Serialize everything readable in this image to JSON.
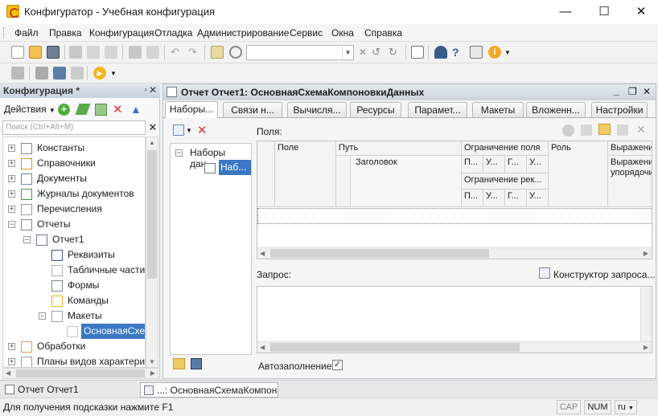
{
  "window": {
    "title": "Конфигуратор - Учебная конфигурация",
    "controls": [
      "—",
      "☐",
      "✕"
    ]
  },
  "menu": [
    "Файл",
    "Правка",
    "Конфигурация",
    "Отладка",
    "Администрирование",
    "Сервис",
    "Окна",
    "Справка"
  ],
  "left_panel": {
    "title": "Конфигурация *",
    "actions_label": "Действия",
    "search_placeholder": "Поиск (Ctrl+Alt+M)",
    "tree": [
      {
        "label": "Константы",
        "level": 0,
        "toggle": "+"
      },
      {
        "label": "Справочники",
        "level": 0,
        "toggle": "+"
      },
      {
        "label": "Документы",
        "level": 0,
        "toggle": "+"
      },
      {
        "label": "Журналы документов",
        "level": 0,
        "toggle": "+"
      },
      {
        "label": "Перечисления",
        "level": 0,
        "toggle": "+"
      },
      {
        "label": "Отчеты",
        "level": 0,
        "toggle": "−"
      },
      {
        "label": "Отчет1",
        "level": 1,
        "toggle": "−"
      },
      {
        "label": "Реквизиты",
        "level": 2,
        "toggle": ""
      },
      {
        "label": "Табличные части",
        "level": 2,
        "toggle": ""
      },
      {
        "label": "Формы",
        "level": 2,
        "toggle": ""
      },
      {
        "label": "Команды",
        "level": 2,
        "toggle": ""
      },
      {
        "label": "Макеты",
        "level": 2,
        "toggle": "−"
      },
      {
        "label": "ОсновнаяСхем",
        "level": 3,
        "toggle": "",
        "selected": true
      },
      {
        "label": "Обработки",
        "level": 0,
        "toggle": "+"
      },
      {
        "label": "Планы видов характерист",
        "level": 0,
        "toggle": "+"
      }
    ]
  },
  "doc": {
    "title": "Отчет Отчет1: ОсновнаяСхемаКомпоновкиДанных",
    "tabs": [
      "Наборы...",
      "Связи н...",
      "Вычисля...",
      "Ресурсы",
      "Парамет...",
      "Макеты",
      "Вложенн...",
      "Настройки"
    ],
    "fields_label": "Поля:",
    "sets_tree_root": "Наборы дан...",
    "sets_tree_child": "Наб...",
    "columns": {
      "field": "Поле",
      "path": "Путь",
      "field_restriction": "Ограничение поля",
      "role": "Роль",
      "expression": "Выражени",
      "expression_order": "Выражени упорядочи",
      "details_restriction": "Ограничение рек...",
      "sub_p": "П...",
      "sub_u": "У...",
      "sub_g": "Г...",
      "sub_u2": "У..."
    },
    "path_row_title": "Заголовок",
    "query_label": "Запрос:",
    "query_builder": "Конструктор запроса...",
    "autofill_label": "Автозаполнение",
    "autofill_checked": true
  },
  "taskbar": [
    "Отчет Отчет1",
    "...: ОсновнаяСхемаКомпон..."
  ],
  "statusbar": {
    "hint": "Для получения подсказки нажмите F1",
    "cap": "CAP",
    "num": "NUM",
    "lang": "ru"
  }
}
